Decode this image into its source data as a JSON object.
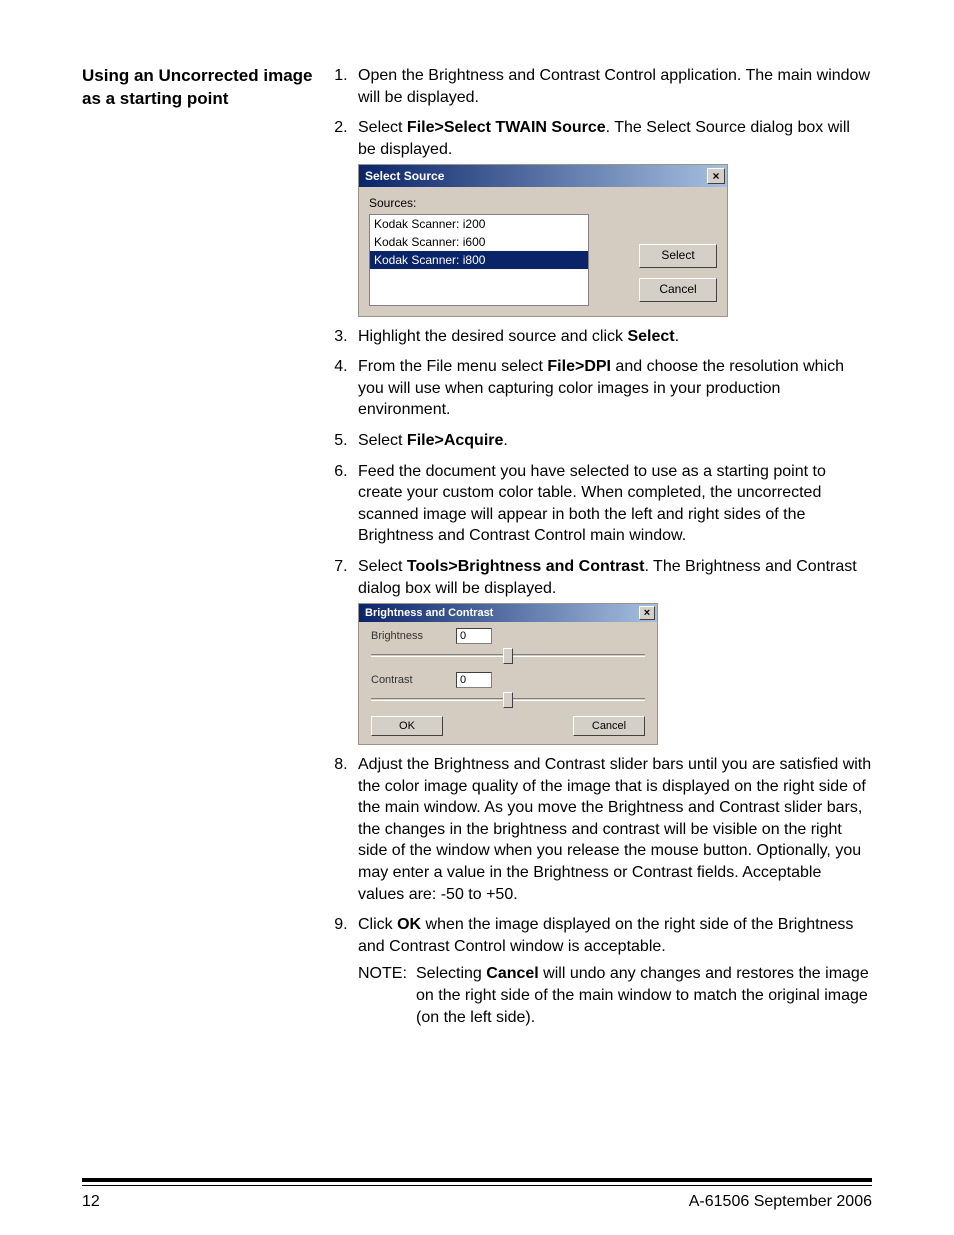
{
  "side_heading": "Using an Uncorrected image as a starting point",
  "steps": {
    "s1": "Open the Brightness and Contrast Control application. The main window will be displayed.",
    "s2a": "Select ",
    "s2b": "File>Select TWAIN Source",
    "s2c": ". The Select Source dialog box will be displayed.",
    "s3a": "Highlight the desired source and click ",
    "s3b": "Select",
    "s3c": ".",
    "s4a": "From the File menu select ",
    "s4b": "File>DPI",
    "s4c": " and choose the resolution which you will use when capturing color images in your production environment.",
    "s5a": "Select ",
    "s5b": "File>Acquire",
    "s5c": ".",
    "s6": "Feed the document you have selected to use as a starting point to create your custom color table. When completed, the uncorrected scanned image will appear in both the left and right sides of the Brightness and Contrast Control main window.",
    "s7a": "Select ",
    "s7b": "Tools>Brightness and Contrast",
    "s7c": ". The Brightness and Contrast dialog box will be displayed.",
    "s8": "Adjust the Brightness and Contrast slider bars until you are satisfied with the color image quality of the image that is displayed on the right side of the main window. As you move the Brightness and Contrast slider bars, the changes in the brightness and contrast will be visible on the right side of the window when you release the mouse button. Optionally, you may enter a value in the Brightness or Contrast fields. Acceptable values are: -50 to +50.",
    "s9a": "Click ",
    "s9b": "OK",
    "s9c": " when the image displayed on the right side of the Brightness and Contrast Control window is acceptable."
  },
  "note": {
    "label": "NOTE:",
    "a": "Selecting ",
    "b": "Cancel",
    "c": " will undo any changes and restores the image on the right side of the main window to match the original image (on the left side)."
  },
  "select_source": {
    "title": "Select Source",
    "close": "×",
    "sources_label": "Sources:",
    "items": [
      "Kodak Scanner: i200",
      "Kodak Scanner: i600",
      "Kodak Scanner: i800"
    ],
    "select_btn": "Select",
    "cancel_btn": "Cancel"
  },
  "bc": {
    "title": "Brightness and Contrast",
    "close": "×",
    "brightness_label": "Brightness",
    "brightness_value": "0",
    "contrast_label": "Contrast",
    "contrast_value": "0",
    "ok": "OK",
    "cancel": "Cancel"
  },
  "footer": {
    "page": "12",
    "docid": "A-61506   September 2006"
  }
}
